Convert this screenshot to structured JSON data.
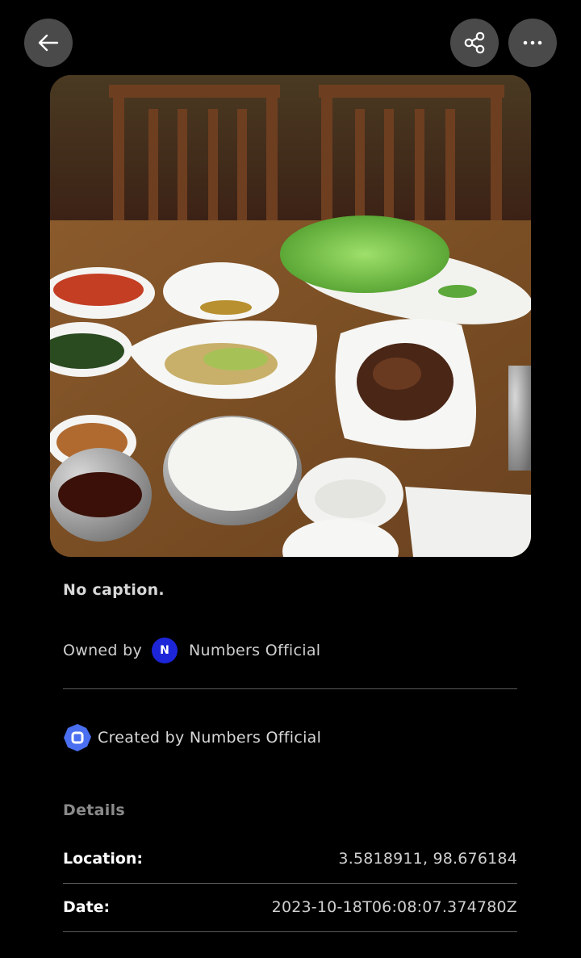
{
  "topbar": {
    "back_icon": "arrow-left-icon",
    "share_icon": "share-icon",
    "more_icon": "more-horizontal-icon"
  },
  "photo": {
    "subject": "korean-meal-table-photo"
  },
  "caption": "No caption.",
  "owner": {
    "label": "Owned by",
    "avatar_letter": "N",
    "name": "Numbers Official",
    "avatar_color": "#1d25d8"
  },
  "creator": {
    "text": "Created by Numbers Official",
    "icon": "numbers-logo-icon",
    "icon_color": "#4a6ff0"
  },
  "details": {
    "heading": "Details",
    "rows": [
      {
        "key": "Location:",
        "value": "3.5818911, 98.676184"
      },
      {
        "key": "Date:",
        "value": "2023-10-18T06:08:07.374780Z"
      }
    ]
  },
  "colors": {
    "background": "#000000",
    "button_bg": "#4a4a4a",
    "divider": "#5a5a5a"
  }
}
